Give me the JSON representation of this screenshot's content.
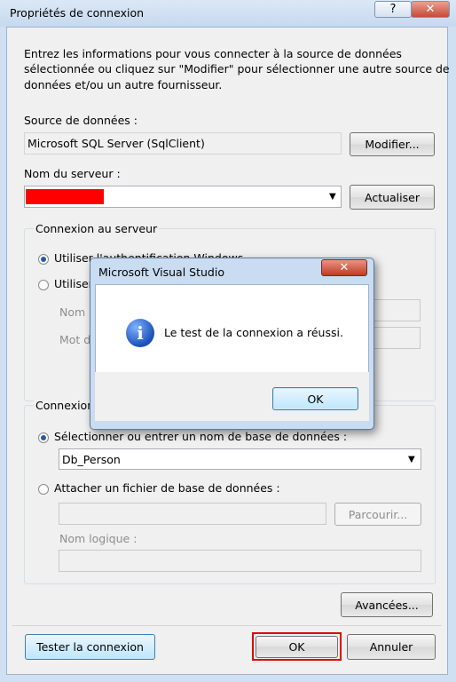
{
  "window": {
    "title": "Propriétés de connexion",
    "help_icon": "?",
    "close_icon": "✕"
  },
  "intro": {
    "line1": "Entrez les informations pour vous connecter à la source de données",
    "line2": "sélectionnée ou cliquez sur \"Modifier\" pour sélectionner une autre source de",
    "line3": "données et/ou un autre fournisseur."
  },
  "datasource": {
    "label": "Source de données :",
    "value": "Microsoft SQL Server (SqlClient)",
    "modify_button": "Modifier..."
  },
  "server": {
    "label": "Nom du serveur :",
    "value": "",
    "redacted_color": "#ff0000",
    "refresh_button": "Actualiser"
  },
  "login_group": {
    "legend": "Connexion au serveur",
    "windows_auth": "Utiliser l'authentification Windows",
    "sql_auth": "Utiliser",
    "user_label": "Nom",
    "password_label": "Mot d"
  },
  "db_group": {
    "legend": "Connexion",
    "select_db": "Sélectionner ou entrer un nom de base de données :",
    "db_value": "Db_Person",
    "attach_file": "Attacher un fichier de base de données :",
    "browse_button": "Parcourir...",
    "logical_name_label": "Nom logique :"
  },
  "footer": {
    "advanced_button": "Avancées...",
    "test_button": "Tester la connexion",
    "ok_button": "OK",
    "cancel_button": "Annuler",
    "ok_highlight_color": "#e00000"
  },
  "modal": {
    "title": "Microsoft Visual Studio",
    "message": "Le test de la connexion a réussi.",
    "ok_button": "OK",
    "close_icon": "✕",
    "info_icon": "i"
  }
}
